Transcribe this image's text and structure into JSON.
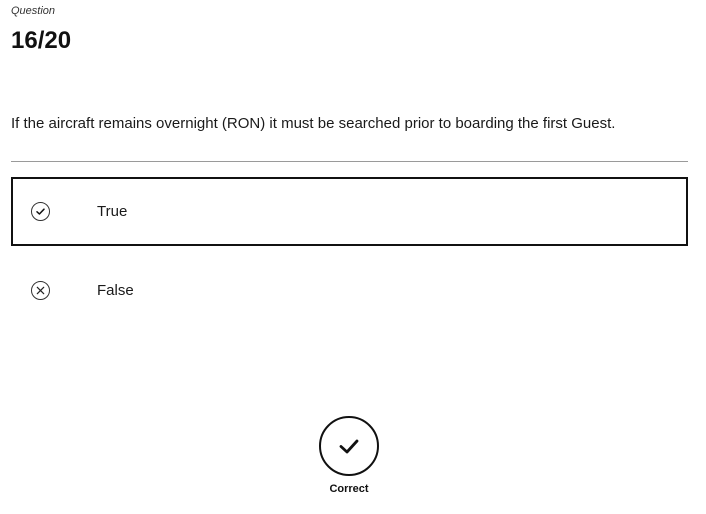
{
  "header": {
    "label": "Question",
    "progress": "16/20"
  },
  "question": {
    "text": "If the aircraft remains overnight (RON) it must be searched prior to boarding the first Guest."
  },
  "options": [
    {
      "label": "True",
      "icon": "check-circle-icon",
      "selected": true
    },
    {
      "label": "False",
      "icon": "x-circle-icon",
      "selected": false
    }
  ],
  "result": {
    "label": "Correct",
    "icon": "check-circle-icon"
  },
  "colors": {
    "text": "#1a1a1a",
    "border": "#111111",
    "divider": "#9a9a9a"
  }
}
